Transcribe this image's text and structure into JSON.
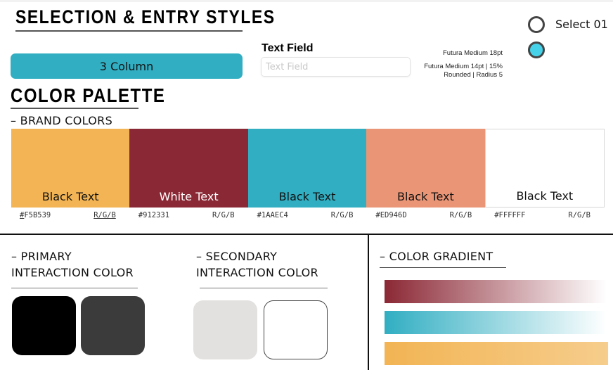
{
  "selection": {
    "title": "SELECTION & ENTRY STYLES",
    "pill_button": {
      "label": "3 Column",
      "color": "#31AEC2"
    },
    "text_field": {
      "label": "Text Field",
      "placeholder": "Text Field",
      "value": ""
    },
    "notes": {
      "label_font": "Futura Medium 18pt",
      "field_spec_line1": "Futura Medium 14pt | 15%",
      "field_spec_line2": "Rounded | Radius 5"
    },
    "radio": {
      "label": "Select 01",
      "selected_color": "#46D3EA",
      "border_color": "#444444"
    }
  },
  "palette": {
    "title": "COLOR PALETTE",
    "brand_title": "– BRAND COLORS",
    "brand_colors": [
      {
        "hex": "#F5B539",
        "display": "#F5B539",
        "text": "Black Text",
        "text_color": "#111111",
        "rgb_label": "R/G/B",
        "fill": "#F2B454"
      },
      {
        "hex": "#912331",
        "display": "#912331",
        "text": "White Text",
        "text_color": "#FFFFFF",
        "rgb_label": "R/G/B",
        "fill": "#8B2835"
      },
      {
        "hex": "#1AAEC4",
        "display": "#1AAEC4",
        "text": "Black Text",
        "text_color": "#111111",
        "rgb_label": "R/G/B",
        "fill": "#31AEC2"
      },
      {
        "hex": "#ED946D",
        "display": "#ED946D",
        "text": "Black Text",
        "text_color": "#111111",
        "rgb_label": "R/G/B",
        "fill": "#EA9576"
      },
      {
        "hex": "#FFFFFF",
        "display": "#FFFFFF",
        "text": "Black Text",
        "text_color": "#111111",
        "rgb_label": "R/G/B",
        "fill": "#FFFFFF"
      }
    ],
    "primary": {
      "title_line1": "– PRIMARY",
      "title_line2": "INTERACTION COLOR",
      "colors": [
        "#000000",
        "#3B3B3B"
      ]
    },
    "secondary": {
      "title_line1": "– SECONDARY",
      "title_line2": "INTERACTION COLOR",
      "colors": [
        "#E2E1DF",
        "#FFFFFF"
      ]
    },
    "gradient": {
      "title": "– COLOR GRADIENT",
      "bars": [
        {
          "from": "#8B2835",
          "to": "#FFFFFF"
        },
        {
          "from": "#31AEC2",
          "to": "#FFFFFF"
        },
        {
          "from": "#F2B454",
          "to": "#F6CD8C"
        }
      ]
    }
  }
}
